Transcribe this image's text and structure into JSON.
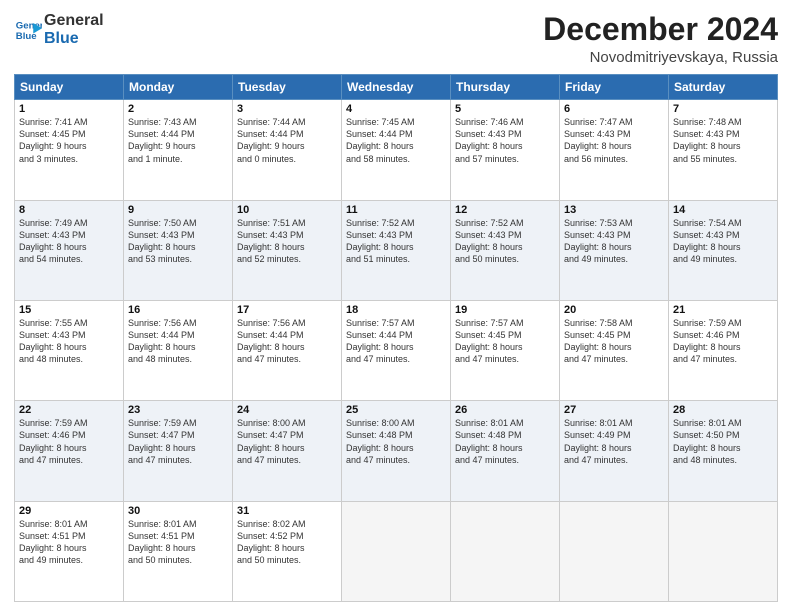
{
  "header": {
    "logo_line1": "General",
    "logo_line2": "Blue",
    "month": "December 2024",
    "location": "Novodmitriyevskaya, Russia"
  },
  "weekdays": [
    "Sunday",
    "Monday",
    "Tuesday",
    "Wednesday",
    "Thursday",
    "Friday",
    "Saturday"
  ],
  "weeks": [
    [
      {
        "day": "1",
        "info": "Sunrise: 7:41 AM\nSunset: 4:45 PM\nDaylight: 9 hours\nand 3 minutes."
      },
      {
        "day": "2",
        "info": "Sunrise: 7:43 AM\nSunset: 4:44 PM\nDaylight: 9 hours\nand 1 minute."
      },
      {
        "day": "3",
        "info": "Sunrise: 7:44 AM\nSunset: 4:44 PM\nDaylight: 9 hours\nand 0 minutes."
      },
      {
        "day": "4",
        "info": "Sunrise: 7:45 AM\nSunset: 4:44 PM\nDaylight: 8 hours\nand 58 minutes."
      },
      {
        "day": "5",
        "info": "Sunrise: 7:46 AM\nSunset: 4:43 PM\nDaylight: 8 hours\nand 57 minutes."
      },
      {
        "day": "6",
        "info": "Sunrise: 7:47 AM\nSunset: 4:43 PM\nDaylight: 8 hours\nand 56 minutes."
      },
      {
        "day": "7",
        "info": "Sunrise: 7:48 AM\nSunset: 4:43 PM\nDaylight: 8 hours\nand 55 minutes."
      }
    ],
    [
      {
        "day": "8",
        "info": "Sunrise: 7:49 AM\nSunset: 4:43 PM\nDaylight: 8 hours\nand 54 minutes."
      },
      {
        "day": "9",
        "info": "Sunrise: 7:50 AM\nSunset: 4:43 PM\nDaylight: 8 hours\nand 53 minutes."
      },
      {
        "day": "10",
        "info": "Sunrise: 7:51 AM\nSunset: 4:43 PM\nDaylight: 8 hours\nand 52 minutes."
      },
      {
        "day": "11",
        "info": "Sunrise: 7:52 AM\nSunset: 4:43 PM\nDaylight: 8 hours\nand 51 minutes."
      },
      {
        "day": "12",
        "info": "Sunrise: 7:52 AM\nSunset: 4:43 PM\nDaylight: 8 hours\nand 50 minutes."
      },
      {
        "day": "13",
        "info": "Sunrise: 7:53 AM\nSunset: 4:43 PM\nDaylight: 8 hours\nand 49 minutes."
      },
      {
        "day": "14",
        "info": "Sunrise: 7:54 AM\nSunset: 4:43 PM\nDaylight: 8 hours\nand 49 minutes."
      }
    ],
    [
      {
        "day": "15",
        "info": "Sunrise: 7:55 AM\nSunset: 4:43 PM\nDaylight: 8 hours\nand 48 minutes."
      },
      {
        "day": "16",
        "info": "Sunrise: 7:56 AM\nSunset: 4:44 PM\nDaylight: 8 hours\nand 48 minutes."
      },
      {
        "day": "17",
        "info": "Sunrise: 7:56 AM\nSunset: 4:44 PM\nDaylight: 8 hours\nand 47 minutes."
      },
      {
        "day": "18",
        "info": "Sunrise: 7:57 AM\nSunset: 4:44 PM\nDaylight: 8 hours\nand 47 minutes."
      },
      {
        "day": "19",
        "info": "Sunrise: 7:57 AM\nSunset: 4:45 PM\nDaylight: 8 hours\nand 47 minutes."
      },
      {
        "day": "20",
        "info": "Sunrise: 7:58 AM\nSunset: 4:45 PM\nDaylight: 8 hours\nand 47 minutes."
      },
      {
        "day": "21",
        "info": "Sunrise: 7:59 AM\nSunset: 4:46 PM\nDaylight: 8 hours\nand 47 minutes."
      }
    ],
    [
      {
        "day": "22",
        "info": "Sunrise: 7:59 AM\nSunset: 4:46 PM\nDaylight: 8 hours\nand 47 minutes."
      },
      {
        "day": "23",
        "info": "Sunrise: 7:59 AM\nSunset: 4:47 PM\nDaylight: 8 hours\nand 47 minutes."
      },
      {
        "day": "24",
        "info": "Sunrise: 8:00 AM\nSunset: 4:47 PM\nDaylight: 8 hours\nand 47 minutes."
      },
      {
        "day": "25",
        "info": "Sunrise: 8:00 AM\nSunset: 4:48 PM\nDaylight: 8 hours\nand 47 minutes."
      },
      {
        "day": "26",
        "info": "Sunrise: 8:01 AM\nSunset: 4:48 PM\nDaylight: 8 hours\nand 47 minutes."
      },
      {
        "day": "27",
        "info": "Sunrise: 8:01 AM\nSunset: 4:49 PM\nDaylight: 8 hours\nand 47 minutes."
      },
      {
        "day": "28",
        "info": "Sunrise: 8:01 AM\nSunset: 4:50 PM\nDaylight: 8 hours\nand 48 minutes."
      }
    ],
    [
      {
        "day": "29",
        "info": "Sunrise: 8:01 AM\nSunset: 4:51 PM\nDaylight: 8 hours\nand 49 minutes."
      },
      {
        "day": "30",
        "info": "Sunrise: 8:01 AM\nSunset: 4:51 PM\nDaylight: 8 hours\nand 50 minutes."
      },
      {
        "day": "31",
        "info": "Sunrise: 8:02 AM\nSunset: 4:52 PM\nDaylight: 8 hours\nand 50 minutes."
      },
      null,
      null,
      null,
      null
    ]
  ]
}
